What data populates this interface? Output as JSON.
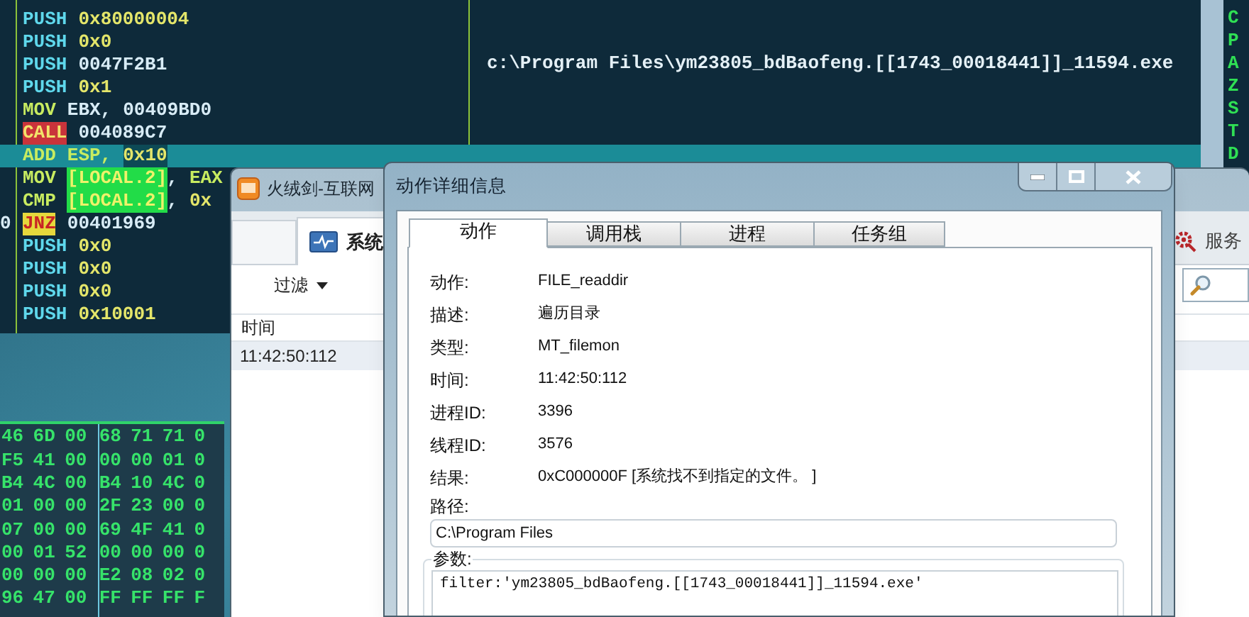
{
  "debugger": {
    "disassembly": [
      {
        "selected": false,
        "tokens": [
          {
            "text": "PUSH",
            "kind": "push"
          },
          {
            "text": "0x80000004",
            "kind": "const"
          }
        ]
      },
      {
        "selected": false,
        "tokens": [
          {
            "text": "PUSH",
            "kind": "push"
          },
          {
            "text": "0x0",
            "kind": "const"
          }
        ]
      },
      {
        "selected": false,
        "tokens": [
          {
            "text": "PUSH",
            "kind": "push"
          },
          {
            "text": "0047F2B1",
            "kind": "addr"
          }
        ]
      },
      {
        "selected": false,
        "tokens": [
          {
            "text": "PUSH",
            "kind": "push"
          },
          {
            "text": "0x1",
            "kind": "const"
          }
        ]
      },
      {
        "selected": false,
        "tokens": [
          {
            "text": "MOV",
            "kind": "op"
          },
          {
            "text": "EBX,",
            "kind": "reg"
          },
          {
            "text": "00409BD0",
            "kind": "addr"
          }
        ]
      },
      {
        "selected": false,
        "tokens": [
          {
            "text": "CALL",
            "kind": "call"
          },
          {
            "text": "004089C7",
            "kind": "addr"
          }
        ]
      },
      {
        "selected": true,
        "tokens": [
          {
            "text": "ADD",
            "kind": "op"
          },
          {
            "text": "ESP,",
            "kind": "op"
          },
          {
            "text": "0x10",
            "kind": "const_boxed"
          }
        ]
      },
      {
        "selected": false,
        "tokens": [
          {
            "text": "MOV",
            "kind": "op"
          },
          {
            "text": "[LOCAL.2]",
            "kind": "local"
          },
          {
            "text": ",",
            "kind": "punct"
          },
          {
            "text": "EAX",
            "kind": "op"
          }
        ]
      },
      {
        "selected": false,
        "tokens": [
          {
            "text": "CMP",
            "kind": "op"
          },
          {
            "text": "[LOCAL.2]",
            "kind": "local"
          },
          {
            "text": ",",
            "kind": "punct"
          },
          {
            "text": "0x",
            "kind": "const"
          }
        ]
      },
      {
        "prefix": "0",
        "selected": false,
        "tokens": [
          {
            "text": "JNZ",
            "kind": "jump"
          },
          {
            "text": "00401969",
            "kind": "addr"
          }
        ]
      },
      {
        "selected": false,
        "tokens": [
          {
            "text": "PUSH",
            "kind": "push"
          },
          {
            "text": "0x0",
            "kind": "const"
          }
        ]
      },
      {
        "selected": false,
        "tokens": [
          {
            "text": "PUSH",
            "kind": "push"
          },
          {
            "text": "0x0",
            "kind": "const"
          }
        ]
      },
      {
        "selected": false,
        "tokens": [
          {
            "text": "PUSH",
            "kind": "push"
          },
          {
            "text": "0x0",
            "kind": "const"
          }
        ]
      },
      {
        "selected": false,
        "tokens": [
          {
            "text": "PUSH",
            "kind": "push"
          },
          {
            "text": "0x10001",
            "kind": "const"
          }
        ]
      }
    ],
    "comment": "c:\\Program Files\\ym23805_bdBaofeng.[[1743_00018441]]_11594.exe",
    "flags": [
      "C",
      "P",
      "A",
      "Z",
      "S",
      "T",
      "D"
    ]
  },
  "hex_dump": {
    "rows": [
      [
        "46",
        "6D",
        "00",
        "68",
        "71",
        "71",
        "0"
      ],
      [
        "F5",
        "41",
        "00",
        "00",
        "00",
        "01",
        "0"
      ],
      [
        "B4",
        "4C",
        "00",
        "B4",
        "10",
        "4C",
        "0"
      ],
      [
        "01",
        "00",
        "00",
        "2F",
        "23",
        "00",
        "0"
      ],
      [
        "07",
        "00",
        "00",
        "69",
        "4F",
        "41",
        "0"
      ],
      [
        "00",
        "01",
        "52",
        "00",
        "00",
        "00",
        "0"
      ],
      [
        "00",
        "00",
        "00",
        "E2",
        "08",
        "02",
        "0"
      ],
      [
        "96",
        "47",
        "00",
        "FF",
        "FF",
        "FF",
        "F"
      ]
    ]
  },
  "background_window": {
    "title": "火绒剑-互联网",
    "tabs": [
      {
        "label": "系统",
        "selected": true
      },
      {
        "label": "服务",
        "selected": false
      }
    ],
    "filter": "过滤",
    "columns": [
      "时间"
    ],
    "rows": [
      [
        "11:42:50:112"
      ]
    ]
  },
  "dialog": {
    "title": "动作详细信息",
    "tabs": [
      {
        "label": "动作",
        "selected": true
      },
      {
        "label": "调用栈",
        "selected": false
      },
      {
        "label": "进程",
        "selected": false
      },
      {
        "label": "任务组",
        "selected": false
      }
    ],
    "fields": [
      {
        "label": "动作:",
        "value": "FILE_readdir"
      },
      {
        "label": "描述:",
        "value": "遍历目录"
      },
      {
        "label": "类型:",
        "value": "MT_filemon"
      },
      {
        "label": "时间:",
        "value": "11:42:50:112"
      },
      {
        "label": "进程ID:",
        "value": "3396"
      },
      {
        "label": "线程ID:",
        "value": "3576"
      },
      {
        "label": "结果:",
        "value": "0xC000000F [系统找不到指定的文件。 ]"
      }
    ],
    "path": {
      "label": "路径:",
      "value": "C:\\Program Files"
    },
    "params": {
      "label": "参数:",
      "value": "filter:'ym23805_bdBaofeng.[[1743_00018441]]_11594.exe'"
    }
  }
}
